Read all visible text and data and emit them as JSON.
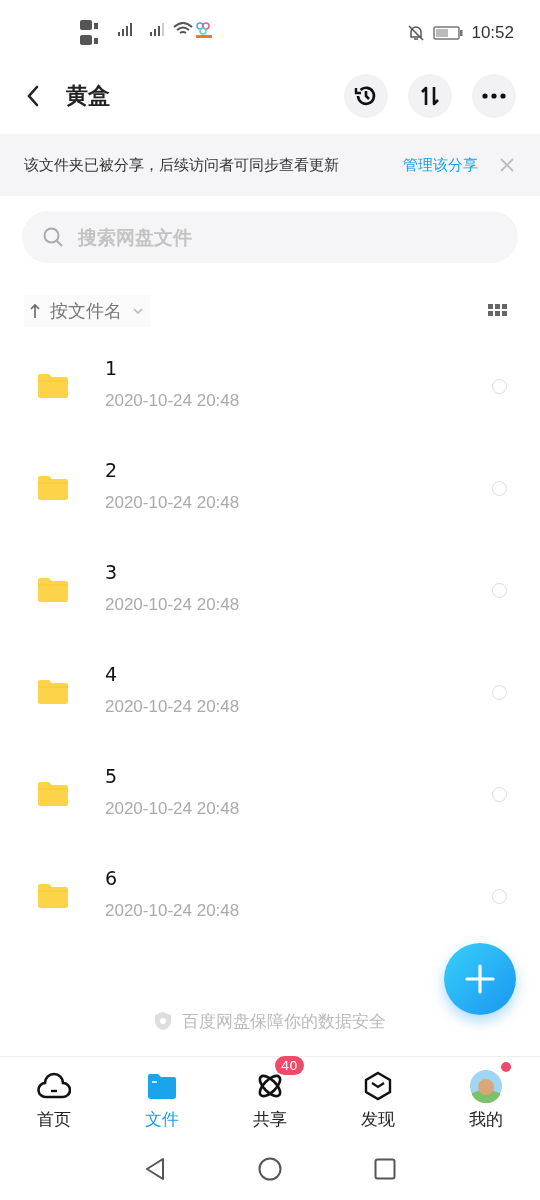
{
  "status_bar": {
    "time": "10:52"
  },
  "header": {
    "title": "黄盒"
  },
  "share_banner": {
    "text": "该文件夹已被分享，后续访问者可同步查看更新",
    "link": "管理该分享"
  },
  "search": {
    "placeholder": "搜索网盘文件"
  },
  "sort": {
    "label": "按文件名"
  },
  "files": [
    {
      "name": "1",
      "date": "2020-10-24  20:48",
      "selected": false
    },
    {
      "name": "2",
      "date": "2020-10-24  20:48",
      "selected": false
    },
    {
      "name": "3",
      "date": "2020-10-24  20:48",
      "selected": false
    },
    {
      "name": "4",
      "date": "2020-10-24  20:48",
      "selected": false
    },
    {
      "name": "5",
      "date": "2020-10-24  20:48",
      "selected": false
    },
    {
      "name": "6",
      "date": "2020-10-24  20:48",
      "selected": false
    }
  ],
  "footer_note": "百度网盘保障你的数据安全",
  "tabs": [
    {
      "kind": "home",
      "label": "首页",
      "selected": false
    },
    {
      "kind": "files",
      "label": "文件",
      "selected": true
    },
    {
      "kind": "share",
      "label": "共享",
      "selected": false,
      "badge": "40"
    },
    {
      "kind": "discover",
      "label": "发现",
      "selected": false
    },
    {
      "kind": "me",
      "label": "我的",
      "selected": false,
      "dot": true
    }
  ]
}
